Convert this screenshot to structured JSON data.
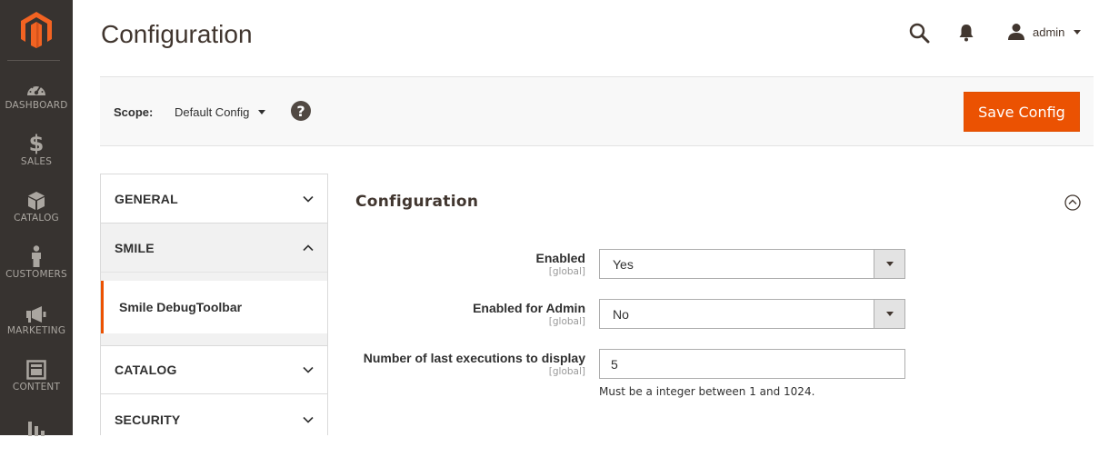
{
  "nav": {
    "items": [
      {
        "label": "DASHBOARD",
        "icon": "dashboard-gauge-icon"
      },
      {
        "label": "SALES",
        "icon": "dollar-icon"
      },
      {
        "label": "CATALOG",
        "icon": "box-icon"
      },
      {
        "label": "CUSTOMERS",
        "icon": "person-icon"
      },
      {
        "label": "MARKETING",
        "icon": "megaphone-icon"
      },
      {
        "label": "CONTENT",
        "icon": "layout-icon"
      },
      {
        "label": "",
        "icon": "bar-chart-icon"
      }
    ]
  },
  "header": {
    "title": "Configuration",
    "user": "admin"
  },
  "scope": {
    "label": "Scope:",
    "value": "Default Config",
    "help": "?",
    "save_label": "Save Config"
  },
  "tabs": [
    {
      "label": "GENERAL",
      "open": false
    },
    {
      "label": "SMILE",
      "open": true,
      "items": [
        "Smile DebugToolbar"
      ]
    },
    {
      "label": "CATALOG",
      "open": false
    },
    {
      "label": "SECURITY",
      "open": false
    }
  ],
  "section": {
    "title": "Configuration",
    "fields": [
      {
        "label": "Enabled",
        "scope": "[global]",
        "value": "Yes"
      },
      {
        "label": "Enabled for Admin",
        "scope": "[global]",
        "value": "No"
      },
      {
        "label": "Number of last executions to display",
        "scope": "[global]",
        "value": "5",
        "note": "Must be a integer between 1 and 1024."
      }
    ]
  },
  "colors": {
    "accent": "#eb5202",
    "nav_bg": "#373330",
    "logo": "#f26322"
  }
}
